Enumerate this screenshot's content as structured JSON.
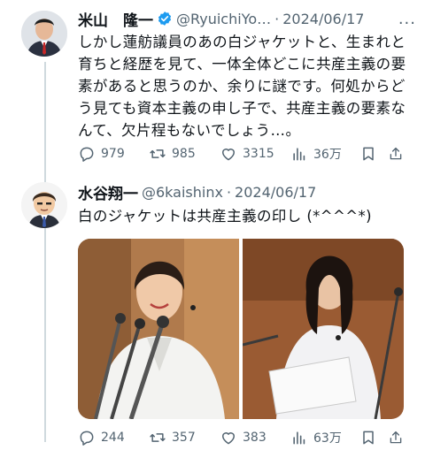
{
  "tweets": [
    {
      "author_name": "米山　隆一",
      "verified": true,
      "handle": "@RyuichiYo…",
      "separator": "·",
      "date": "2024/06/17",
      "text": "しかし蓮舫議員のあの白ジャケットと、生まれと育ちと経歴を見て、一体全体どこに共産主義の要素があると思うのか、余りに謎です。何処からどう見ても資本主義の申し子で、共産主義の要素なんて、欠片程もないでしょう…。",
      "more_label": "···",
      "replies": "979",
      "retweets": "985",
      "likes": "3315",
      "views": "36万",
      "icons": [
        "reply-icon",
        "retweet-icon",
        "like-icon",
        "views-icon",
        "bookmark-icon",
        "share-icon"
      ]
    },
    {
      "author_name": "水谷翔一",
      "verified": false,
      "handle": "@6kaishinx",
      "separator": "·",
      "date": "2024/06/17",
      "text": "白のジャケットは共産主義の印し (*^^^*)",
      "replies": "244",
      "retweets": "357",
      "likes": "383",
      "views": "63万",
      "icons": [
        "reply-icon",
        "retweet-icon",
        "like-icon",
        "views-icon",
        "bookmark-icon",
        "share-icon"
      ]
    }
  ],
  "colors": {
    "text": "#0f1419",
    "secondary": "#536471",
    "verified": "#1d9bf0",
    "thread_line": "#cfd9de"
  }
}
